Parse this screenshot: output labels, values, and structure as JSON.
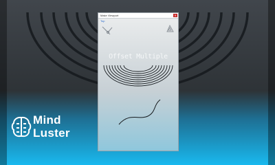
{
  "window": {
    "title": "Make Viewport"
  },
  "viewport": {
    "label": "Top"
  },
  "heading": "Offset Multiple",
  "watermark": {
    "line1": "Mind",
    "line2": "Luster"
  },
  "icons": [
    "compass-icon",
    "triangle-icon",
    "brain-logo-icon",
    "close-icon"
  ],
  "colors": {
    "background_top": "#3c4147",
    "background_bottom": "#1bb3e8",
    "arc_stroke": "#15191d",
    "close_button": "#c62828"
  }
}
